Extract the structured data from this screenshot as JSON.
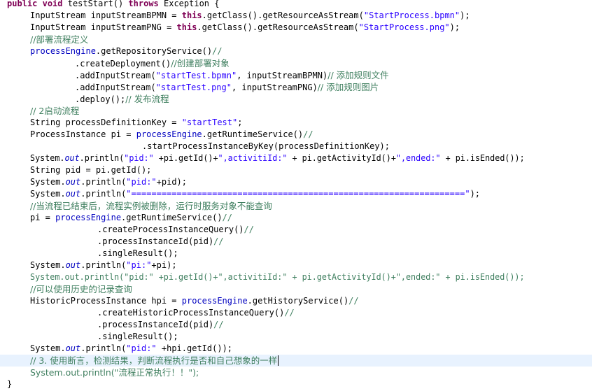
{
  "code": {
    "l01": {
      "kw1": "public",
      "kw2": "void",
      "a": " testStart() ",
      "kw3": "throws",
      "b": " Exception {"
    },
    "l02": {
      "a": "InputStream inputStreamBPMN = ",
      "kw": "this",
      "b": ".getClass().getResourceAsStream(",
      "s": "\"StartProcess.bpmn\"",
      "c": ");"
    },
    "l03": {
      "a": "InputStream inputStreamPNG = ",
      "kw": "this",
      "b": ".getClass().getResourceAsStream(",
      "s": "\"StartProcess.png\"",
      "c": ");"
    },
    "l04": {
      "cm": "//部署流程定义"
    },
    "l05": {
      "f": "processEngine",
      "a": ".getRepositoryService()",
      "cm": "//"
    },
    "l06": {
      "a": ".createDeployment()",
      "cm": "//创建部署对象"
    },
    "l07": {
      "a": ".addInputStream(",
      "s": "\"startTest.bpmn\"",
      "b": ", inputStreamBPMN)",
      "cm": "// 添加规则文件"
    },
    "l08": {
      "a": ".addInputStream(",
      "s": "\"startTest.png\"",
      "b": ", inputStreamPNG)",
      "cm": "// 添加规则图片"
    },
    "l09": {
      "a": ".deploy();",
      "cm": "// 发布流程"
    },
    "l10": {
      "cm": "// 2启动流程"
    },
    "l11": {
      "a": "String processDefinitionKey = ",
      "s": "\"startTest\"",
      "b": ";"
    },
    "l12": {
      "a": "ProcessInstance pi = ",
      "f": "processEngine",
      "b": ".getRuntimeService()",
      "cm": "//"
    },
    "l13": {
      "a": ".startProcessInstanceByKey(processDefinitionKey);"
    },
    "l14": {
      "a": "System.",
      "o": "out",
      "b": ".println(",
      "s1": "\"pid:\"",
      "c": " +pi.getId()+",
      "s2": "\",activitiId:\"",
      "d": " + pi.getActivityId()+",
      "s3": "\",ended:\"",
      "e": " + pi.isEnded());"
    },
    "l15": {
      "a": "String pid = pi.getId();"
    },
    "l16": {
      "a": "System.",
      "o": "out",
      "b": ".println(",
      "s": "\"pid:\"",
      "c": "+pid);"
    },
    "l17": {
      "a": "System.",
      "o": "out",
      "b": ".println(",
      "s": "\"==================================================================\"",
      "c": ");"
    },
    "l18": {
      "cm": "//当流程已结束后，流程实例被删除，运行时服务对象不能查询"
    },
    "l19": {
      "a": "pi = ",
      "f": "processEngine",
      "b": ".getRuntimeService()",
      "cm": "//"
    },
    "l20": {
      "a": ".createProcessInstanceQuery()",
      "cm": "//"
    },
    "l21": {
      "a": ".processInstanceId(pid)",
      "cm": "//"
    },
    "l22": {
      "a": ".singleResult();"
    },
    "l23": {
      "a": "System.",
      "o": "out",
      "b": ".println(",
      "s": "\"pi:\"",
      "c": "+pi);"
    },
    "l24": {
      "cm": "System.out.println(\"pid:\" +pi.getId()+\",activitiId:\" + pi.getActivityId()+\",ended:\" + pi.isEnded());"
    },
    "l25": {
      "cm": "//可以使用历史的记录查询"
    },
    "l26": {
      "a": "HistoricProcessInstance hpi = ",
      "f": "processEngine",
      "b": ".getHistoryService()",
      "cm": "//"
    },
    "l27": {
      "a": ".createHistoricProcessInstanceQuery()",
      "cm": "//"
    },
    "l28": {
      "a": ".processInstanceId(pid)",
      "cm": "//"
    },
    "l29": {
      "a": ".singleResult();"
    },
    "l30": {
      "a": "System.",
      "o": "out",
      "b": ".println(",
      "s": "\"pid:\"",
      "c": " +hpi.getId());"
    },
    "l31": {
      "cm": "// 3. 使用断言，检测结果，判断流程执行是否和自己想象的一样"
    },
    "l32": {
      "cm": "System.out.println(\"流程正常执行！！\");"
    },
    "l33": {
      "a": "}"
    }
  }
}
